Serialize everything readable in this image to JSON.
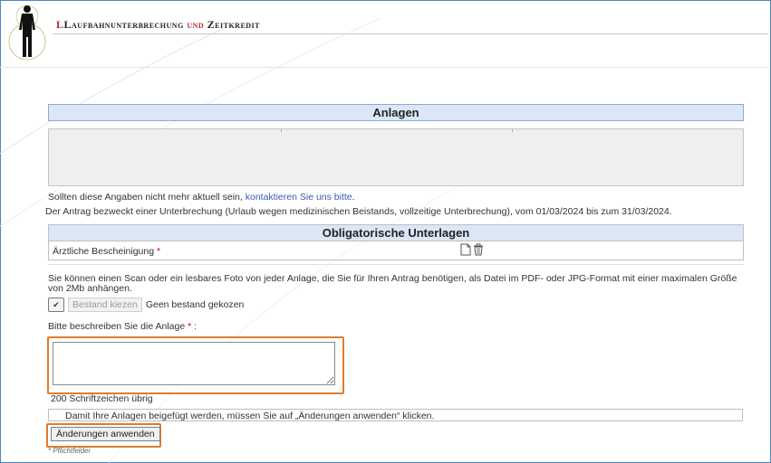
{
  "header": {
    "title_part1": "Laufbahnunterbrechung ",
    "title_und": "und",
    "title_part2": " Zeitkredit"
  },
  "anlagen": {
    "heading": "Anlagen",
    "contact_text": "Sollten diese Angaben nicht mehr aktuell sein, ",
    "contact_link": "kontaktieren Sie uns bitte",
    "contact_end": ".",
    "request_text": "Der Antrag bezweckt einer Unterbrechung (Urlaub wegen medizinischen Beistands, vollzeitige Unterbrechung), vom 01/03/2024 bis zum 31/03/2024."
  },
  "obligatory": {
    "heading": "Obligatorische Unterlagen",
    "row_label": "Ärztliche Bescheinigung",
    "required_marker": " *"
  },
  "upload": {
    "instructions": "Sie können einen Scan oder ein lesbares Foto von jeder Anlage, die Sie für Ihren Antrag benötigen, als Datei im PDF- oder JPG-Format mit einer maximalen Größe von 2Mb anhängen.",
    "browse_button": "Bestand kiezen",
    "no_file_text": "Geen bestand gekozen",
    "describe_label": "Bitte beschreiben Sie die Anlage",
    "describe_required": " * :",
    "chars_left": "200 Schriftzeichen übrig"
  },
  "notice": "Damit Ihre Anlagen beigefügt werden, müssen Sie auf „Änderungen anwenden“ klicken.",
  "apply_button": "Änderungen anwenden",
  "footnote": "* Pflichtfelder",
  "colors": {
    "accent_red": "#c0272d",
    "section_bg": "#dbe6f6",
    "highlight": "#e27b2c",
    "link": "#3a5fa8"
  }
}
